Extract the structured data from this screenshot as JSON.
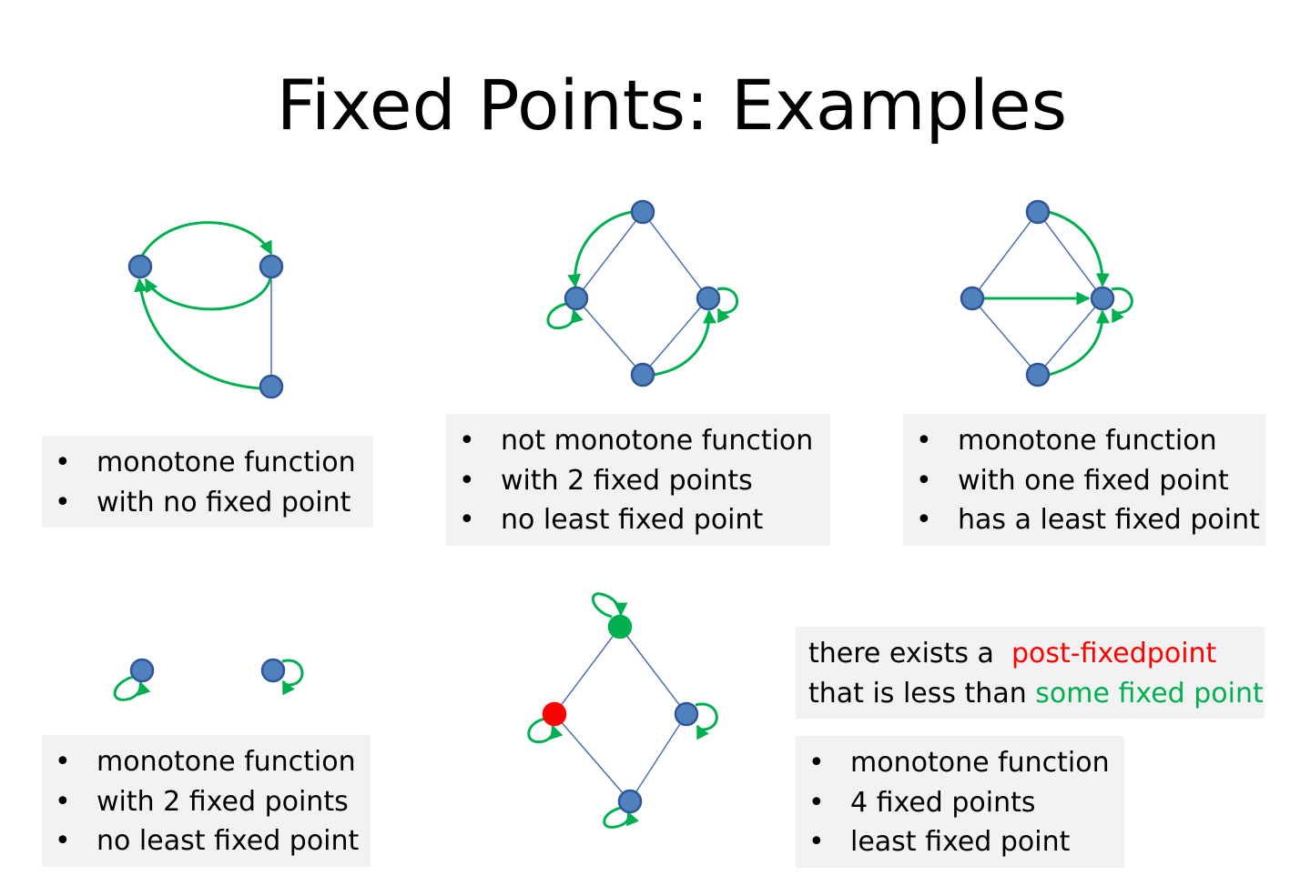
{
  "title": "Fixed Points: Examples",
  "colors": {
    "node_fill": "#4f81bd",
    "node_stroke": "#2f5597",
    "order_edge": "#4a72b0",
    "function_arrow": "#00b050",
    "fixed_highlight": "#00b050",
    "post_fixed_highlight": "#ff0000",
    "caption_box": "#f2f2f2"
  },
  "captions": {
    "ex1": [
      "monotone function",
      "with no fixed point"
    ],
    "ex2": [
      "not monotone function",
      "with 2 fixed points",
      "no least fixed point"
    ],
    "ex3": [
      "monotone function",
      "with one fixed point",
      "has a least fixed point"
    ],
    "ex4": [
      "monotone function",
      "with 2 fixed points",
      "no least fixed point"
    ],
    "ex5": [
      "monotone function",
      "4 fixed points",
      "least fixed point"
    ]
  },
  "bullet_symbol": "•",
  "note": {
    "line1_prefix": "there exists a",
    "line1_highlight": "post-fixedpoint",
    "line2_prefix": "that is less than",
    "line2_highlight": "some fixed point"
  }
}
